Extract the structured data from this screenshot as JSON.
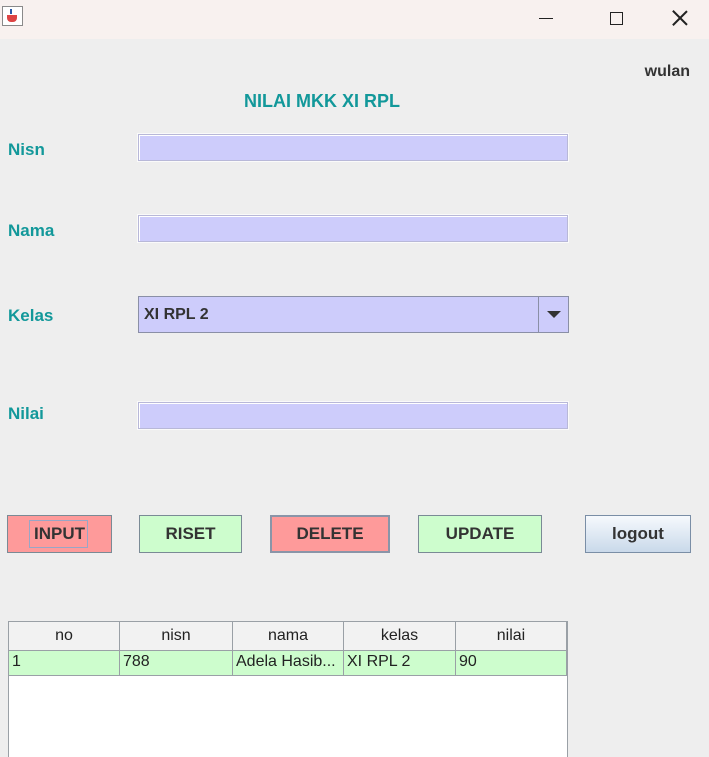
{
  "window": {
    "icon": "java-cup-icon",
    "controls": [
      "minimize-icon",
      "maximize-icon",
      "close-icon"
    ]
  },
  "header": {
    "user": "wulan",
    "title": "NILAI MKK XI RPL"
  },
  "form": {
    "nisn_label": "Nisn",
    "nisn_value": "",
    "nama_label": "Nama",
    "nama_value": "",
    "kelas_label": "Kelas",
    "kelas_value": "XI RPL 2",
    "nilai_label": "Nilai",
    "nilai_value": ""
  },
  "buttons": {
    "input": "INPUT",
    "riset": "RISET",
    "delete": "DELETE",
    "update": "UPDATE",
    "logout": "logout"
  },
  "colors": {
    "accent": "#12989a",
    "field_bg": "#cdccfb",
    "button_red": "#fe9a9a",
    "button_green": "#cdfdcd"
  },
  "table": {
    "columns": [
      "no",
      "nisn",
      "nama",
      "kelas",
      "nilai"
    ],
    "rows": [
      [
        "1",
        "788",
        "Adela Hasib...",
        "XI RPL 2",
        "90"
      ]
    ]
  }
}
